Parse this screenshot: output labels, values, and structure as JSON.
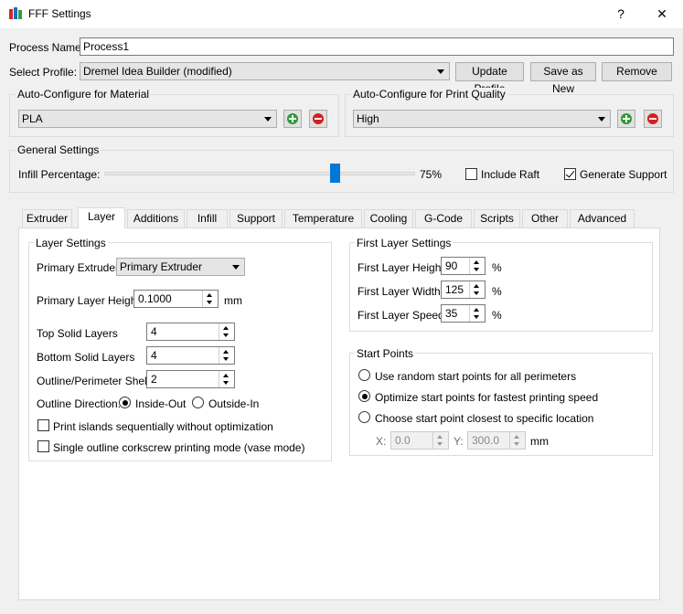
{
  "window": {
    "title": "FFF Settings",
    "help_label": "?",
    "close_label": "✕"
  },
  "process": {
    "name_label": "Process Name:",
    "name_value": "Process1"
  },
  "profile": {
    "label": "Select Profile:",
    "selected": "Dremel Idea Builder (modified)",
    "update_button": "Update Profile",
    "save_as_new_button": "Save as New",
    "remove_button": "Remove"
  },
  "material": {
    "title": "Auto-Configure for Material",
    "selected": "PLA"
  },
  "quality": {
    "title": "Auto-Configure for Print Quality",
    "selected": "High"
  },
  "general": {
    "title": "General Settings",
    "infill_label": "Infill Percentage:",
    "infill_value": 75,
    "infill_text": "75%",
    "include_raft_label": "Include Raft",
    "include_raft_checked": false,
    "generate_support_label": "Generate Support",
    "generate_support_checked": true
  },
  "tabs": [
    {
      "label": "Extruder",
      "active": false
    },
    {
      "label": "Layer",
      "active": true
    },
    {
      "label": "Additions",
      "active": false
    },
    {
      "label": "Infill",
      "active": false
    },
    {
      "label": "Support",
      "active": false
    },
    {
      "label": "Temperature",
      "active": false
    },
    {
      "label": "Cooling",
      "active": false
    },
    {
      "label": "G-Code",
      "active": false
    },
    {
      "label": "Scripts",
      "active": false
    },
    {
      "label": "Other",
      "active": false
    },
    {
      "label": "Advanced",
      "active": false
    }
  ],
  "layer": {
    "title": "Layer Settings",
    "primary_extruder_label": "Primary Extruder",
    "primary_extruder_value": "Primary Extruder",
    "primary_layer_height_label": "Primary Layer Height",
    "primary_layer_height_value": "0.1000",
    "primary_layer_height_unit": "mm",
    "top_solid_layers_label": "Top Solid Layers",
    "top_solid_layers_value": "4",
    "bottom_solid_layers_label": "Bottom Solid Layers",
    "bottom_solid_layers_value": "4",
    "outline_shells_label": "Outline/Perimeter Shells",
    "outline_shells_value": "2",
    "outline_direction_label": "Outline Direction:",
    "inside_out_label": "Inside-Out",
    "outside_in_label": "Outside-In",
    "outline_direction_selected": "Inside-Out",
    "print_islands_label": "Print islands sequentially without optimization",
    "print_islands_checked": false,
    "vase_mode_label": "Single outline corkscrew printing mode (vase mode)",
    "vase_mode_checked": false
  },
  "first_layer": {
    "title": "First Layer Settings",
    "height_label": "First Layer Height",
    "height_value": "90",
    "width_label": "First Layer Width",
    "width_value": "125",
    "speed_label": "First Layer Speed",
    "speed_value": "35",
    "unit": "%"
  },
  "start_points": {
    "title": "Start Points",
    "random_label": "Use random start points for all perimeters",
    "optimize_label": "Optimize start points for fastest printing speed",
    "closest_label": "Choose start point closest to specific location",
    "selected": "optimize",
    "x_label": "X:",
    "x_value": "0.0",
    "y_label": "Y:",
    "y_value": "300.0",
    "unit": "mm"
  },
  "colors": {
    "accent": "#0078d7",
    "add": "#2e9a34",
    "remove": "#d81e1e"
  }
}
